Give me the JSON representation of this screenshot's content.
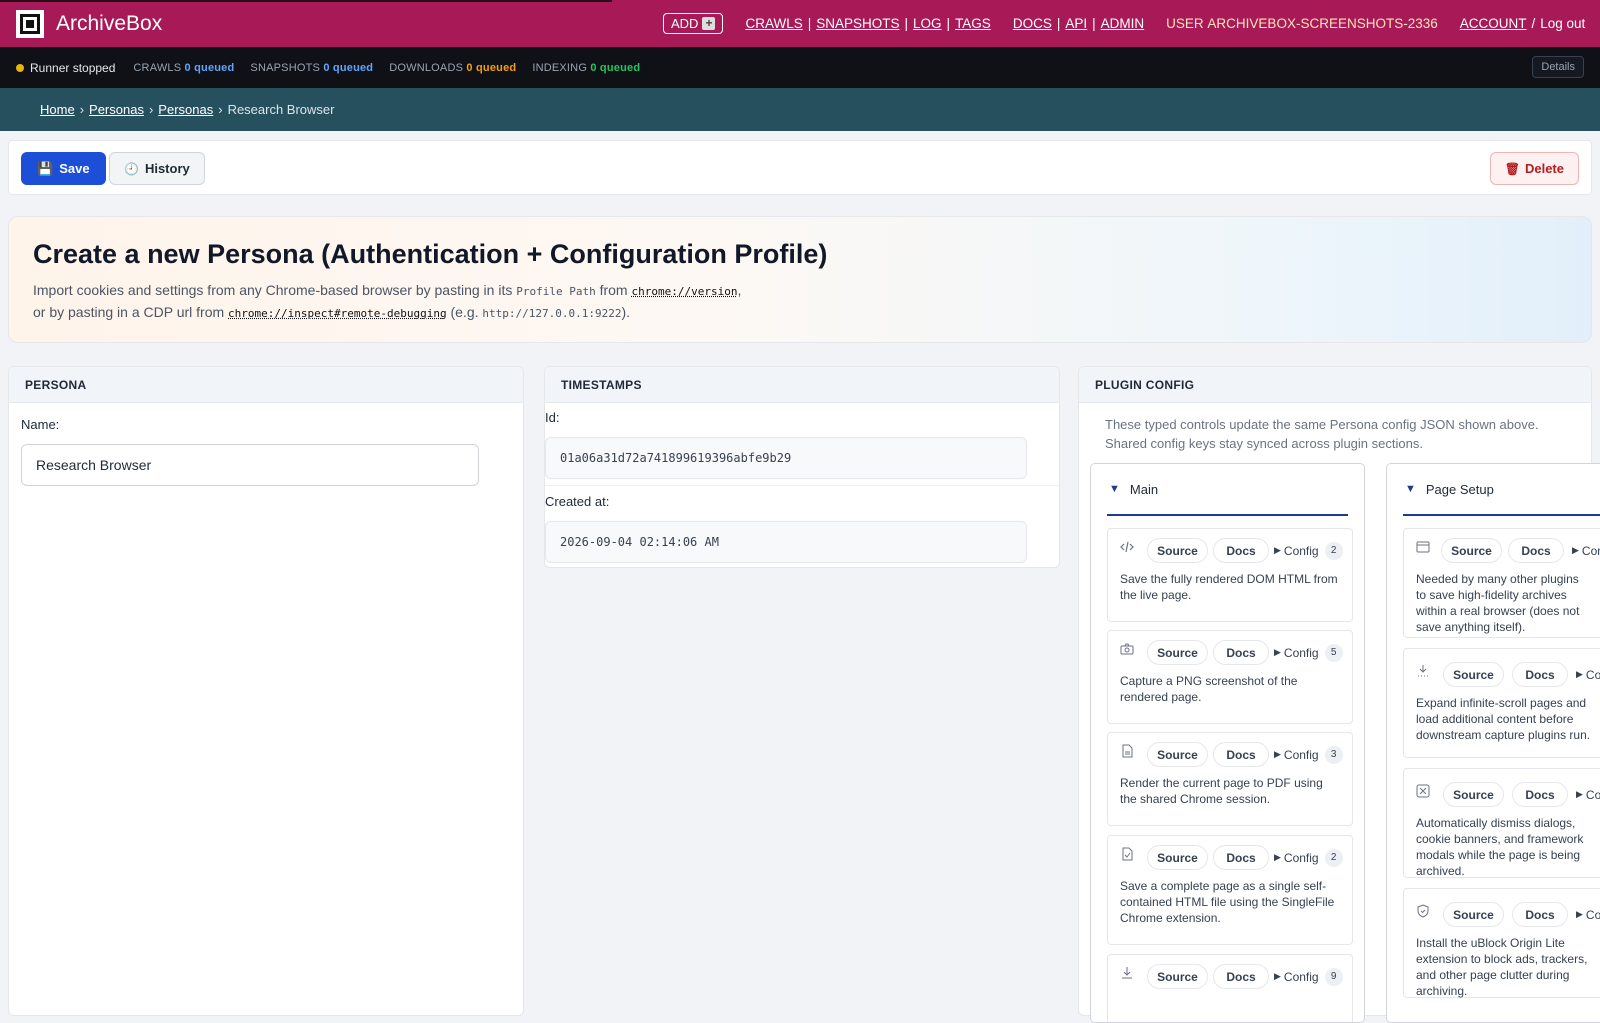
{
  "header": {
    "brand": "ArchiveBox",
    "add_label": "ADD",
    "nav": {
      "crawls": "CRAWLS",
      "snapshots": "SNAPSHOTS",
      "log": "LOG",
      "tags": "TAGS",
      "docs": "DOCS",
      "api": "API",
      "admin": "ADMIN",
      "user_prefix": "USER",
      "username": "ARCHIVEBOX-SCREENSHOTS-2336",
      "account": "ACCOUNT",
      "logout": "Log out"
    },
    "colors": {
      "accent": "#a81a57"
    }
  },
  "status": {
    "runner": "Runner stopped",
    "crawls_label": "CRAWLS",
    "crawls_value": "0 queued",
    "snapshots_label": "SNAPSHOTS",
    "snapshots_value": "0 queued",
    "downloads_label": "DOWNLOADS",
    "downloads_value": "0 queued",
    "indexing_label": "INDEXING",
    "indexing_value": "0 queued",
    "details": "Details"
  },
  "breadcrumbs": {
    "home": "Home",
    "personas1": "Personas",
    "personas2": "Personas",
    "current": "Research Browser"
  },
  "actions": {
    "save": "Save",
    "history": "History",
    "delete": "Delete"
  },
  "hero": {
    "title": "Create a new Persona (Authentication + Configuration Profile)",
    "line1_a": "Import cookies and settings from any Chrome-based browser by pasting in its ",
    "line1_code": "Profile Path",
    "line1_b": " from ",
    "line1_link": "chrome://version",
    "line1_c": ",",
    "line2_a": "or by pasting in a CDP url from ",
    "line2_link": "chrome://inspect#remote-debugging",
    "line2_b": " (e.g. ",
    "line2_code": "http://127.0.0.1:9222",
    "line2_c": ")."
  },
  "persona": {
    "title": "PERSONA",
    "name_label": "Name:",
    "name_value": "Research Browser"
  },
  "timestamps": {
    "title": "TIMESTAMPS",
    "id_label": "Id:",
    "id_value": "01a06a31d72a741899619396abfe9b29",
    "created_label": "Created at:",
    "created_value": "2026-09-04 02:14:06 AM"
  },
  "plugin_config": {
    "title": "PLUGIN CONFIG",
    "desc_line1": "These typed controls update the same Persona config JSON shown above.",
    "desc_line2": "Shared config keys stay synced across plugin sections.",
    "source": "Source",
    "docs": "Docs",
    "config": "Config",
    "main": {
      "title": "Main",
      "cards": [
        {
          "icon": "code-icon",
          "count": "2",
          "desc": "Save the fully rendered DOM HTML from the live page."
        },
        {
          "icon": "camera-icon",
          "count": "5",
          "desc": "Capture a PNG screenshot of the rendered page."
        },
        {
          "icon": "file-icon",
          "count": "3",
          "desc": "Render the current page to PDF using the shared Chrome session."
        },
        {
          "icon": "file-check-icon",
          "count": "2",
          "desc": "Save a complete page as a single self-contained HTML file using the SingleFile Chrome extension."
        },
        {
          "icon": "download-icon",
          "count": "9",
          "desc": ""
        }
      ]
    },
    "page_setup": {
      "title": "Page Setup",
      "cards": [
        {
          "icon": "browser-window-icon",
          "desc": "Needed by many other plugins to save high-fidelity archives within a real browser (does not save anything itself)."
        },
        {
          "icon": "infinite-scroll-icon",
          "desc": "Expand infinite-scroll pages and load additional content before downstream capture plugins run."
        },
        {
          "icon": "dismiss-x-icon",
          "desc": "Automatically dismiss dialogs, cookie banners, and framework modals while the page is being archived."
        },
        {
          "icon": "shield-icon",
          "desc": "Install the uBlock Origin Lite extension to block ads, trackers, and other page clutter during archiving."
        }
      ]
    }
  }
}
